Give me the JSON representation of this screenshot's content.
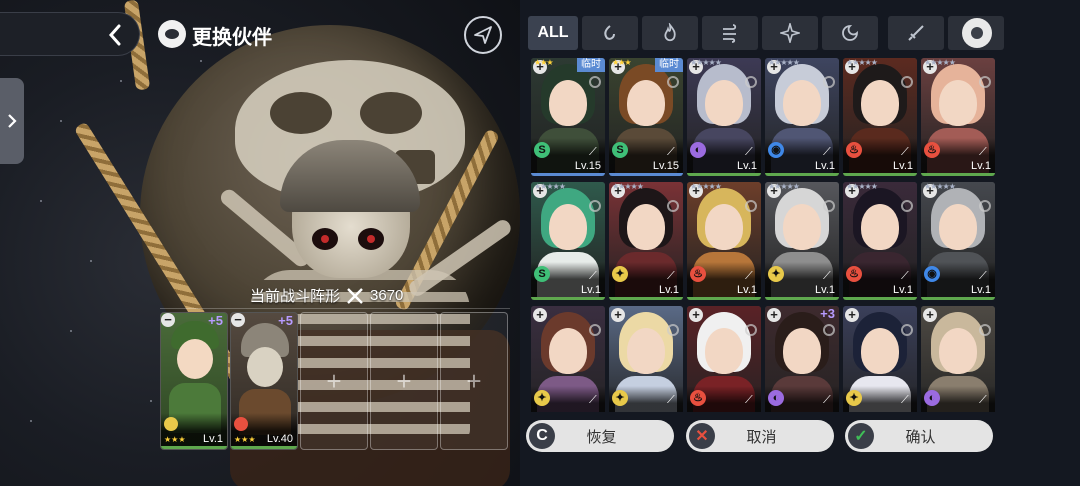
{
  "header": {
    "back_icon": "chevron-left-icon",
    "title": "更换伙伴",
    "send_icon": "paper-plane-icon",
    "side_tab_icon": "chevron-right-icon"
  },
  "formation": {
    "label": "当前战斗阵形",
    "power": "3670",
    "slots": [
      {
        "state": "filled",
        "bonus": "+5",
        "stars": "★★★",
        "level": "Lv.1",
        "element": "light"
      },
      {
        "state": "filled",
        "bonus": "+5",
        "stars": "★★★",
        "level": "Lv.40",
        "element": "fire"
      },
      {
        "state": "empty"
      },
      {
        "state": "empty"
      },
      {
        "state": "empty"
      }
    ]
  },
  "filters": {
    "all_label": "ALL",
    "items": [
      "water-element-icon",
      "fire-element-icon",
      "wind-element-icon",
      "light-element-icon",
      "dark-element-icon",
      "sword-icon",
      "staff-icon"
    ],
    "badge_icon": "medal-icon"
  },
  "cards": [
    {
      "tag": "临时",
      "element": "wind",
      "stars": "★★★",
      "level": "Lv.15",
      "hair": "#253a2b",
      "body": "#3f4f3a",
      "bg": "#2d3a33",
      "bar": "#5b8bd3"
    },
    {
      "tag": "临时",
      "element": "wind",
      "stars": "★★★",
      "level": "Lv.15",
      "hair": "#7a4a25",
      "body": "#5a4a38",
      "bg": "#3a4430",
      "bar": "#5b8bd3"
    },
    {
      "tag": "",
      "element": "dark",
      "stars": "★★★★★",
      "level": "Lv.1",
      "hair": "#b7bccc",
      "body": "#474660",
      "bg": "#3d3a55",
      "bar": "#5fa84e"
    },
    {
      "tag": "",
      "element": "water",
      "stars": "★★★★★",
      "level": "Lv.1",
      "hair": "#c7ccd8",
      "body": "#505674",
      "bg": "#3e4560",
      "bar": "#5fa84e"
    },
    {
      "tag": "",
      "element": "fire",
      "stars": "★★★★★",
      "level": "Lv.1",
      "hair": "#1e1a1a",
      "body": "#5a2a1e",
      "bg": "#5c2a20",
      "bar": "#5fa84e"
    },
    {
      "tag": "",
      "element": "fire",
      "stars": "★★★★★",
      "level": "Lv.1",
      "hair": "#e6b39a",
      "body": "#a35c56",
      "bg": "#6b4040",
      "bar": "#5fa84e"
    },
    {
      "tag": "",
      "element": "wind",
      "stars": "★★★★★",
      "level": "Lv.1",
      "hair": "#3fa881",
      "body": "#e7ece9",
      "bg": "#2f5a4c",
      "bar": "#5fa84e"
    },
    {
      "tag": "",
      "element": "light",
      "stars": "★★★★★",
      "level": "Lv.1",
      "hair": "#1d1618",
      "body": "#6b2a2c",
      "bg": "#7a3236",
      "bar": "#5fa84e"
    },
    {
      "tag": "",
      "element": "fire",
      "stars": "★★★★★",
      "level": "Lv.1",
      "hair": "#d7b65c",
      "body": "#b7763a",
      "bg": "#6d3e2a",
      "bar": "#5fa84e"
    },
    {
      "tag": "",
      "element": "light",
      "stars": "★★★★★",
      "level": "Lv.1",
      "hair": "#d6d6d6",
      "body": "#8e8e8e",
      "bg": "#56575c",
      "bar": "#5fa84e"
    },
    {
      "tag": "",
      "element": "fire",
      "stars": "★★★★★",
      "level": "Lv.1",
      "hair": "#1b1623",
      "body": "#3a2630",
      "bg": "#3a2a3a",
      "bar": "#5fa84e"
    },
    {
      "tag": "",
      "element": "water",
      "stars": "★★★★★",
      "level": "Lv.1",
      "hair": "#b0b2b6",
      "body": "#505357",
      "bg": "#45484e",
      "bar": "#5fa84e"
    },
    {
      "tag": "",
      "element": "light",
      "stars": "",
      "level": "",
      "hair": "#6b3a2c",
      "body": "#7d5a86",
      "bg": "#3a2e40",
      "bar": ""
    },
    {
      "tag": "",
      "element": "light",
      "stars": "",
      "level": "",
      "hair": "#ecd9a5",
      "body": "#c5cfe0",
      "bg": "#5a6a86",
      "bar": ""
    },
    {
      "tag": "",
      "element": "fire",
      "stars": "",
      "level": "",
      "hair": "#f0f0f0",
      "body": "#7a2226",
      "bg": "#5a2226",
      "bar": ""
    },
    {
      "tag": "",
      "element": "dark",
      "stars": "",
      "level": "",
      "hair": "#2a1d1a",
      "body": "#5a3a3a",
      "bg": "#3e2a2e",
      "bar": "",
      "bonus": "+3"
    },
    {
      "tag": "",
      "element": "light",
      "stars": "",
      "level": "",
      "hair": "#1c2238",
      "body": "#e7e7ef",
      "bg": "#3a3f5a",
      "bar": ""
    },
    {
      "tag": "",
      "element": "dark",
      "stars": "",
      "level": "",
      "hair": "#c9b89c",
      "body": "#8a7e6e",
      "bg": "#4e4a44",
      "bar": ""
    }
  ],
  "actions": {
    "reset_label": "恢复",
    "cancel_label": "取消",
    "confirm_label": "确认"
  },
  "colors": {
    "water": "#3f88e8",
    "fire": "#e8503f",
    "wind": "#3fbf77",
    "light": "#e8c94a",
    "dark": "#9b6be0",
    "cancel": "#d6392f",
    "confirm": "#3fbf57",
    "reset": "#3a3e48"
  }
}
